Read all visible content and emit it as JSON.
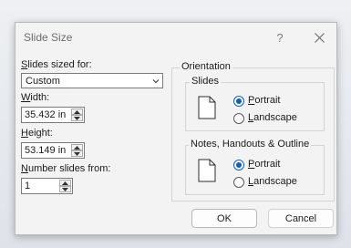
{
  "dialog": {
    "title": "Slide Size",
    "help_label": "?"
  },
  "left": {
    "slides_sized_for": {
      "label_underline": "S",
      "label_rest": "lides sized for:",
      "value": "Custom"
    },
    "width": {
      "label_underline": "W",
      "label_rest": "idth:",
      "value": "35.432 in"
    },
    "height": {
      "label_underline": "H",
      "label_rest": "eight:",
      "value": "53.149 in"
    },
    "number_from": {
      "label_underline": "N",
      "label_rest": "umber slides from:",
      "value": "1"
    }
  },
  "orientation": {
    "title": "Orientation",
    "slides": {
      "title": "Slides",
      "portrait_underline": "P",
      "portrait_rest": "ortrait",
      "landscape_underline": "L",
      "landscape_rest": "andscape",
      "selected": "portrait"
    },
    "notes": {
      "title": "Notes, Handouts & Outline",
      "portrait_underline": "P",
      "portrait_rest": "ortrait",
      "landscape_underline": "L",
      "landscape_rest": "andscape",
      "selected": "portrait"
    }
  },
  "buttons": {
    "ok": "OK",
    "cancel": "Cancel"
  }
}
